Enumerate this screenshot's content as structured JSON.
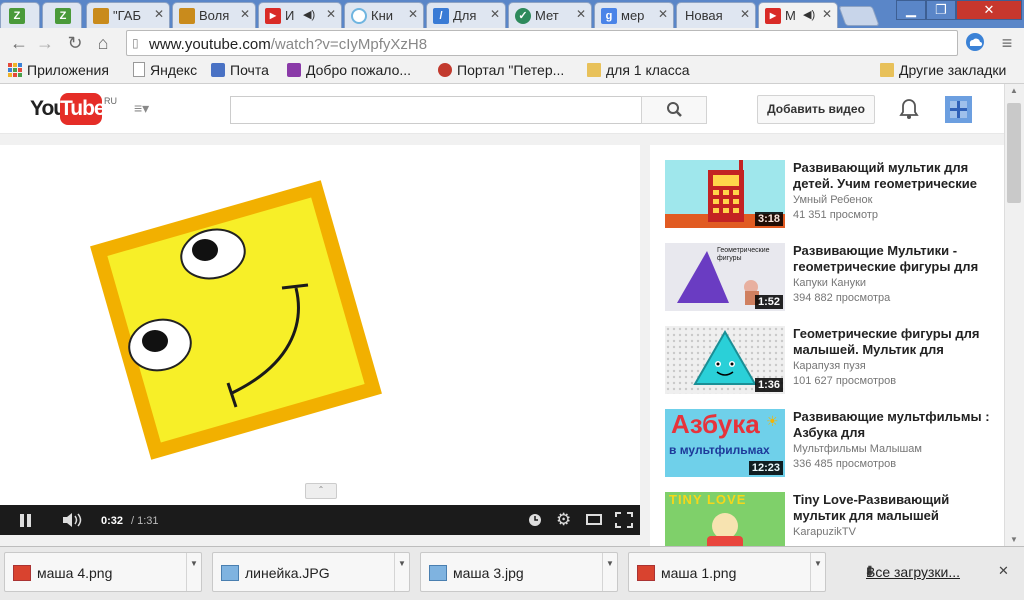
{
  "tabs": [
    {
      "title": "Z",
      "favicon": "z-icon",
      "color": "#4a9a3a"
    },
    {
      "title": "Z",
      "favicon": "z-icon",
      "color": "#4a9a3a"
    },
    {
      "title": "\"ГАБ",
      "favicon": "book-icon",
      "color": "#c98b1c"
    },
    {
      "title": "Воля",
      "favicon": "book-icon",
      "color": "#c98b1c"
    },
    {
      "title": "И",
      "favicon": "youtube-icon",
      "color": "#d92b26"
    },
    {
      "title": "Кни",
      "favicon": "circle-icon",
      "color": "#6fb5e0"
    },
    {
      "title": "Для",
      "favicon": "pencil-icon",
      "color": "#3a7bd5"
    },
    {
      "title": "Мет",
      "favicon": "check-icon",
      "color": "#2e8a5c"
    },
    {
      "title": "мер",
      "favicon": "google-icon",
      "color": "#4a84e8"
    },
    {
      "title": "Новая",
      "favicon": "",
      "color": ""
    },
    {
      "title": "М",
      "favicon": "youtube-icon",
      "color": "#d92b26"
    }
  ],
  "address_bar": {
    "host": "www.youtube.com",
    "path": "/watch?v=cIyMpfyXzH8"
  },
  "bookmarks": [
    {
      "label": "Приложения",
      "icon": "apps-grid-icon"
    },
    {
      "label": "Яндекс",
      "icon": "page-icon"
    },
    {
      "label": "Почта",
      "icon": "mail-icon"
    },
    {
      "label": "Добро пожало...",
      "icon": "site-icon"
    },
    {
      "label": "Портал \"Петер...",
      "icon": "emblem-icon"
    },
    {
      "label": "для 1 класса",
      "icon": "folder-icon"
    },
    {
      "label": "Другие закладки",
      "icon": "folder-icon"
    }
  ],
  "youtube": {
    "logo_you": "You",
    "logo_tube": "Tube",
    "region": "RU",
    "upload_label": "Добавить видео",
    "brand_color": "#e52d27"
  },
  "player": {
    "current_time": "0:32",
    "separator_total": "/ 1:31",
    "played_fraction": 0.35
  },
  "recommendations": [
    {
      "title": "Развивающий мультик для детей. Учим геометрические",
      "channel": "Умный Ребенок",
      "views": "41 351 просмотр",
      "duration": "3:18"
    },
    {
      "title": "Развивающие Мультики - геометрические фигуры для",
      "channel": "Капуки Кануки",
      "views": "394 882 просмотра",
      "duration": "1:52",
      "thumb_caption": "Геометрические фигуры"
    },
    {
      "title": "Геометрические фигуры для малышей. Мультик для",
      "channel": "Карапузя пузя",
      "views": "101 627 просмотров",
      "duration": "1:36"
    },
    {
      "title": "Развивающие мультфильмы : Азбука для",
      "channel": "Мультфильмы Малышам",
      "views": "336 485 просмотров",
      "duration": "12:23",
      "thumb_line1": "Азбука",
      "thumb_line2": "в мультфильмах"
    },
    {
      "title": "Tiny Love-Развивающий мультик для малышей",
      "channel": "KarapuzikTV",
      "views": "",
      "duration": "",
      "thumb_caption": "TINY LOVE"
    }
  ],
  "downloads": [
    {
      "name": "маша 4.png",
      "icon": "image-red-icon"
    },
    {
      "name": "линейка.JPG",
      "icon": "image-blue-icon"
    },
    {
      "name": "маша 3.jpg",
      "icon": "image-blue-icon"
    },
    {
      "name": "маша 1.png",
      "icon": "image-red-icon"
    }
  ],
  "downloads_all": "Все загрузки..."
}
